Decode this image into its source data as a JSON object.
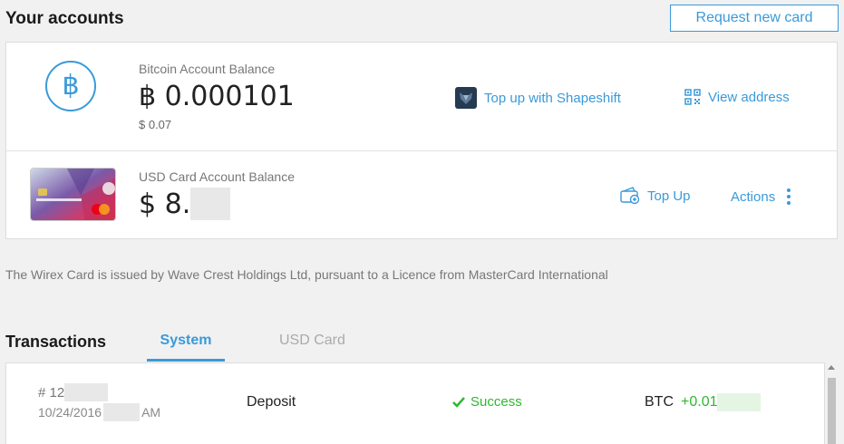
{
  "header": {
    "title": "Your accounts",
    "request_card_label": "Request new card"
  },
  "bitcoin": {
    "icon": "bitcoin-icon",
    "symbol": "฿",
    "label": "Bitcoin Account Balance",
    "balance": "฿ 0.000101",
    "fiat_value": "$ 0.07",
    "topup_label": "Top up with Shapeshift",
    "view_address_label": "View address"
  },
  "usd_card": {
    "label": "USD Card Account Balance",
    "balance": "$ 8.",
    "topup_label": "Top Up",
    "actions_label": "Actions"
  },
  "notice": "The Wirex Card is issued by Wave Crest Holdings Ltd, pursuant to a Licence from MasterCard International",
  "transactions": {
    "title": "Transactions",
    "tabs": [
      {
        "label": "System",
        "active": true
      },
      {
        "label": "USD Card",
        "active": false
      }
    ],
    "rows": [
      {
        "id": "# 12",
        "date": "10/24/2016",
        "time_suffix": "AM",
        "type": "Deposit",
        "status": "Success",
        "currency": "BTC",
        "amount": "+0.01"
      }
    ]
  },
  "colors": {
    "accent": "#3a9ad9",
    "success": "#2eb82e",
    "background": "#f1f1f1"
  }
}
